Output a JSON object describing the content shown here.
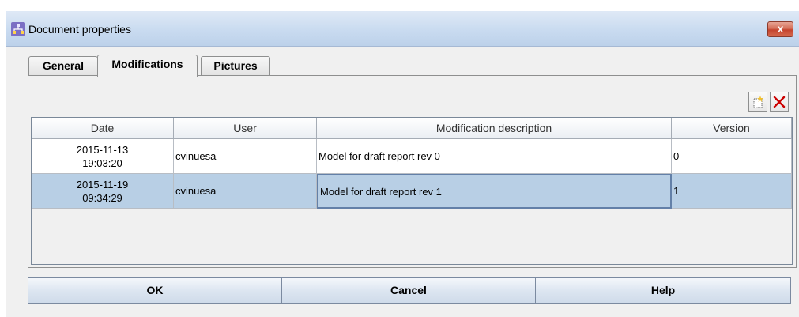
{
  "window": {
    "title": "Document properties",
    "close_label": "x"
  },
  "tabs": [
    {
      "label": "General",
      "active": false
    },
    {
      "label": "Modifications",
      "active": true
    },
    {
      "label": "Pictures",
      "active": false
    }
  ],
  "toolbar": {
    "add_icon": "new-document-icon",
    "delete_icon": "delete-x-icon",
    "delete_color": "#cc0000"
  },
  "table": {
    "columns": [
      "Date",
      "User",
      "Modification description",
      "Version"
    ],
    "rows": [
      {
        "date": "2015-11-13",
        "time": "19:03:20",
        "user": "cvinuesa",
        "description": "Model for draft report rev 0",
        "version": "0",
        "selected": false
      },
      {
        "date": "2015-11-19",
        "time": "09:34:29",
        "user": "cvinuesa",
        "description": "Model for draft report rev 1",
        "version": "1",
        "selected": true
      }
    ]
  },
  "buttons": {
    "ok": "OK",
    "cancel": "Cancel",
    "help": "Help"
  },
  "colors": {
    "selection": "#b8cfe5",
    "titlebar": "#c9dbf0"
  }
}
